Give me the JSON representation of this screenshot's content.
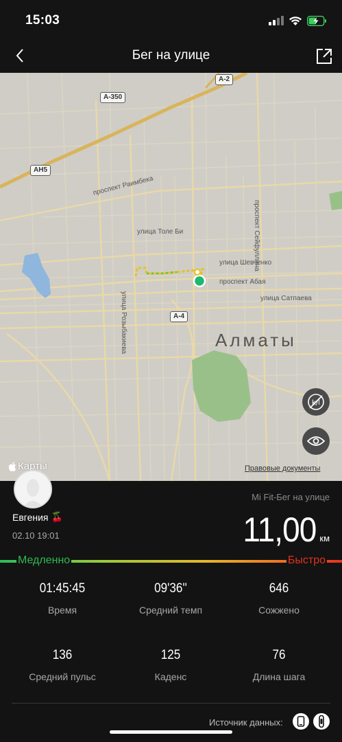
{
  "status_bar": {
    "time": "15:03"
  },
  "nav": {
    "title": "Бег на улице"
  },
  "map": {
    "roads": [
      {
        "text": "A-2",
        "kind": "shield"
      },
      {
        "text": "A-350",
        "kind": "shield"
      },
      {
        "text": "AH5",
        "kind": "shield"
      },
      {
        "text": "A-4",
        "kind": "shield"
      },
      {
        "text": "проспект Раимбека",
        "kind": "label"
      },
      {
        "text": "проспект Сейфуллина",
        "kind": "label"
      },
      {
        "text": "улица Толе Би",
        "kind": "label"
      },
      {
        "text": "улица Шевченко",
        "kind": "label"
      },
      {
        "text": "проспект Абая",
        "kind": "label"
      },
      {
        "text": "улица Сатпаева",
        "kind": "label"
      },
      {
        "text": "улица Розыбакиева",
        "kind": "label"
      }
    ],
    "city": "Алматы",
    "maps_logo": "Карты",
    "legal_link": "Правовые документы"
  },
  "workout": {
    "user_name": "Евгения",
    "user_emoji": "🍒",
    "date": "02.10 19:01",
    "source_title": "Mi Fit-Бег на улице",
    "distance": "11,00",
    "distance_unit": "км",
    "pace_slow": "Медленно",
    "pace_fast": "Быстро",
    "stats": [
      {
        "value": "01:45:45",
        "label": "Время"
      },
      {
        "value": "09'36''",
        "label": "Средний темп"
      },
      {
        "value": "646",
        "label": "Сожжено"
      },
      {
        "value": "136",
        "label": "Средний пульс"
      },
      {
        "value": "125",
        "label": "Каденс"
      },
      {
        "value": "76",
        "label": "Длина шага"
      }
    ],
    "data_source_label": "Источник данных:"
  },
  "colors": {
    "slow": "#2dbb52",
    "fast": "#e0321c",
    "route_start": "#1fb870"
  }
}
